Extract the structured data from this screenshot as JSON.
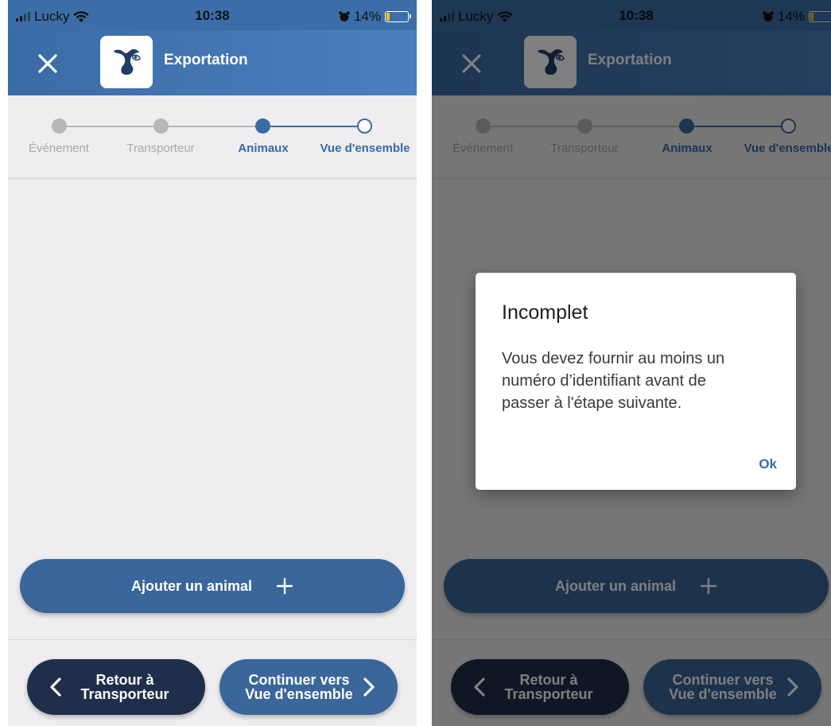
{
  "status_bar": {
    "carrier": "Lucky",
    "time": "10:38",
    "battery": "14%",
    "battery_level": 0.14
  },
  "app_bar": {
    "title": "Exportation",
    "close_icon": "close-icon",
    "logo_icon": "cow-logo-icon"
  },
  "stepper": {
    "steps": [
      {
        "label": "Événement",
        "state": "done"
      },
      {
        "label": "Transporteur",
        "state": "done"
      },
      {
        "label": "Animaux",
        "state": "active"
      },
      {
        "label": "Vue d'ensemble",
        "state": "pending"
      }
    ]
  },
  "add_animal": {
    "label": "Ajouter un animal",
    "icon": "plus-icon"
  },
  "navigation": {
    "back": {
      "line1": "Retour à",
      "line2": "Transporteur",
      "icon": "chevron-left-icon"
    },
    "next": {
      "line1": "Continuer vers",
      "line2": "Vue d'ensemble",
      "icon": "chevron-right-icon"
    }
  },
  "dialog": {
    "title": "Incomplet",
    "message_line1": "Vous devez fournir au moins un",
    "message_line2": "numéro d’identifiant avant de",
    "message_line3": "passer à l'étape suivante.",
    "ok_label": "Ok"
  },
  "colors": {
    "primary": "#3a6ba5",
    "dark": "#1f2e4a",
    "step_inactive": "#b8b6b8",
    "battery_low": "#f5c400",
    "background": "#efedef"
  }
}
